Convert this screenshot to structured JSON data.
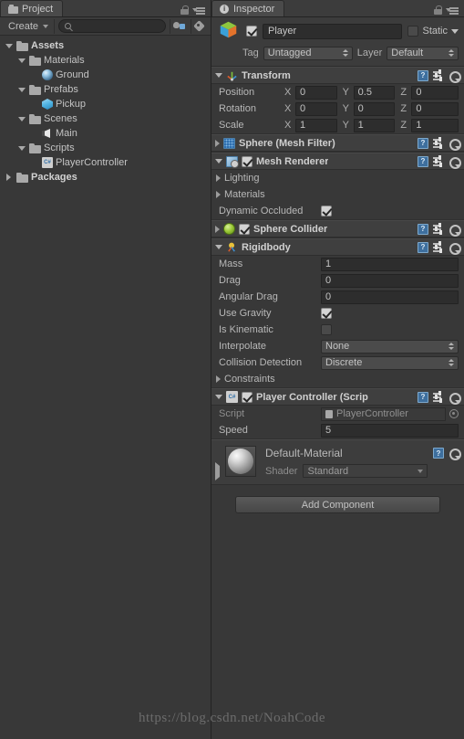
{
  "project_panel": {
    "tab_label": "Project",
    "tab_icon": "folder-icon",
    "lock_icon": "lock-icon",
    "menu_icon": "hamburger-menu-icon",
    "toolbar": {
      "create_label": "Create",
      "search_placeholder": "",
      "search_value": "",
      "search_icon": "search-icon",
      "icon_1": "avatar-collab-icon",
      "icon_2": "label-tag-icon"
    },
    "tree": [
      {
        "label": "Assets",
        "indent": 0,
        "twisty": "down",
        "icon": "folder-icon",
        "bold": true
      },
      {
        "label": "Materials",
        "indent": 1,
        "twisty": "down",
        "icon": "folder-icon",
        "bold": false
      },
      {
        "label": "Ground",
        "indent": 2,
        "twisty": "none",
        "icon": "material-icon",
        "bold": false
      },
      {
        "label": "Prefabs",
        "indent": 1,
        "twisty": "down",
        "icon": "folder-icon",
        "bold": false
      },
      {
        "label": "Pickup",
        "indent": 2,
        "twisty": "none",
        "icon": "prefab-icon",
        "bold": false
      },
      {
        "label": "Scenes",
        "indent": 1,
        "twisty": "down",
        "icon": "folder-icon",
        "bold": false
      },
      {
        "label": "Main",
        "indent": 2,
        "twisty": "none",
        "icon": "scene-icon",
        "bold": false
      },
      {
        "label": "Scripts",
        "indent": 1,
        "twisty": "down",
        "icon": "folder-icon",
        "bold": false
      },
      {
        "label": "PlayerController",
        "indent": 2,
        "twisty": "none",
        "icon": "csharp-script-icon",
        "bold": false
      },
      {
        "label": "Packages",
        "indent": 0,
        "twisty": "right",
        "icon": "folder-icon",
        "bold": true
      }
    ]
  },
  "inspector": {
    "tab_label": "Inspector",
    "tab_icon": "info-icon",
    "lock_icon": "lock-icon",
    "menu_icon": "hamburger-menu-icon",
    "object": {
      "icon": "gameobject-cube-icon",
      "enabled": true,
      "name": "Player",
      "static_label": "Static",
      "static_checked": false,
      "tag_label": "Tag",
      "tag_value": "Untagged",
      "layer_label": "Layer",
      "layer_value": "Default"
    },
    "components": [
      {
        "title": "Transform",
        "icon": "transform-axis-icon",
        "expanded": true,
        "has_checkbox": false,
        "vectors": [
          {
            "label": "Position",
            "x": "0",
            "y": "0.5",
            "z": "0"
          },
          {
            "label": "Rotation",
            "x": "0",
            "y": "0",
            "z": "0"
          },
          {
            "label": "Scale",
            "x": "1",
            "y": "1",
            "z": "1"
          }
        ]
      },
      {
        "title": "Sphere (Mesh Filter)",
        "icon": "mesh-filter-icon",
        "expanded": false,
        "has_checkbox": false
      },
      {
        "title": "Mesh Renderer",
        "icon": "mesh-renderer-icon",
        "expanded": true,
        "has_checkbox": true,
        "checked": true,
        "foldouts": [
          {
            "label": "Lighting"
          },
          {
            "label": "Materials"
          }
        ],
        "checkbox_props": [
          {
            "label": "Dynamic Occluded",
            "checked": true
          }
        ]
      },
      {
        "title": "Sphere Collider",
        "icon": "sphere-collider-icon",
        "expanded": false,
        "has_checkbox": true,
        "checked": true
      },
      {
        "title": "Rigidbody",
        "icon": "rigidbody-icon",
        "expanded": true,
        "has_checkbox": false,
        "props": [
          {
            "label": "Mass",
            "type": "field",
            "value": "1"
          },
          {
            "label": "Drag",
            "type": "field",
            "value": "0"
          },
          {
            "label": "Angular Drag",
            "type": "field",
            "value": "0"
          },
          {
            "label": "Use Gravity",
            "type": "checkbox",
            "checked": true
          },
          {
            "label": "Is Kinematic",
            "type": "checkbox",
            "checked": false
          },
          {
            "label": "Interpolate",
            "type": "dropdown",
            "value": "None"
          },
          {
            "label": "Collision Detection",
            "type": "dropdown",
            "value": "Discrete"
          }
        ],
        "trailing_foldouts": [
          {
            "label": "Constraints"
          }
        ]
      },
      {
        "title": "Player Controller (Scrip",
        "icon": "csharp-script-icon",
        "expanded": true,
        "has_checkbox": true,
        "checked": true,
        "script_row": {
          "label": "Script",
          "value": "PlayerController"
        },
        "props": [
          {
            "label": "Speed",
            "type": "field",
            "value": "5"
          }
        ]
      }
    ],
    "material": {
      "name": "Default-Material",
      "shader_label": "Shader",
      "shader_value": "Standard",
      "preview_icon": "material-sphere-preview"
    },
    "add_component_label": "Add Component"
  },
  "watermark": "https://blog.csdn.net/NoahCode",
  "colors": {
    "window_bg": "#383838",
    "panel_header": "#3c3c3c",
    "component_header": "#3f3f3f",
    "field_bg": "#2d2d2d",
    "text": "#b4b4b4",
    "accent_blue": "#6ea8d4",
    "collider_green": "#9ecb3a"
  }
}
